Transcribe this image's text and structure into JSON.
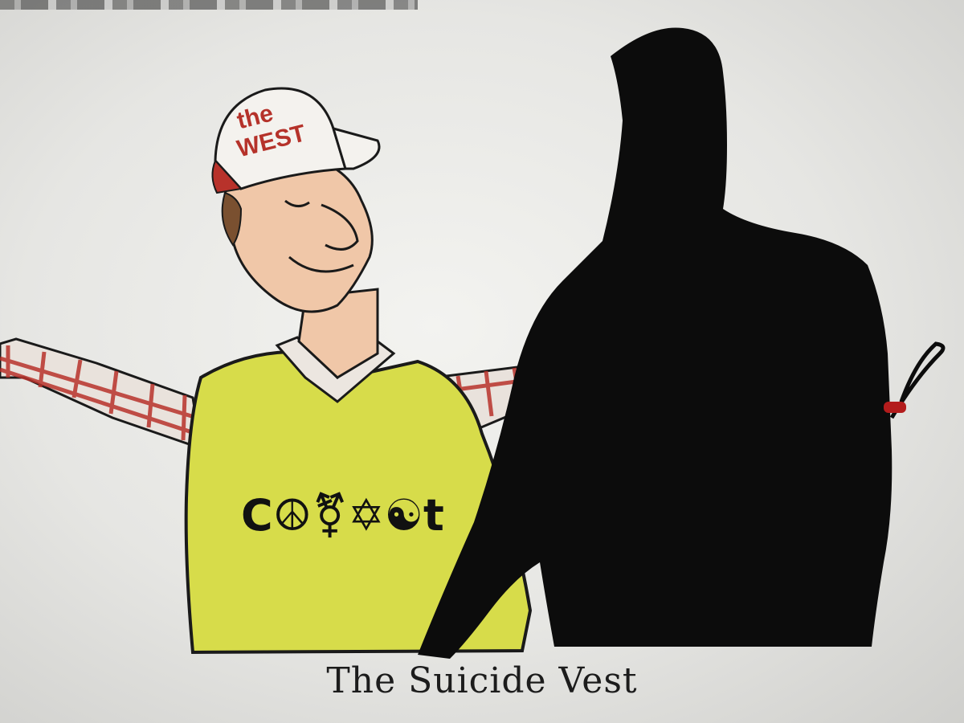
{
  "cartoon": {
    "cap_text_line1": "the",
    "cap_text_line2": "WEST",
    "vest_symbols": "C☮⚧✡☯t",
    "caption": "The Suicide Vest"
  },
  "colors": {
    "vest_yellow": "#d7dc4a",
    "plaid_red": "#b8322b",
    "silhouette": "#0c0c0c",
    "skin": "#f0c7a8",
    "background": "#ececea"
  }
}
